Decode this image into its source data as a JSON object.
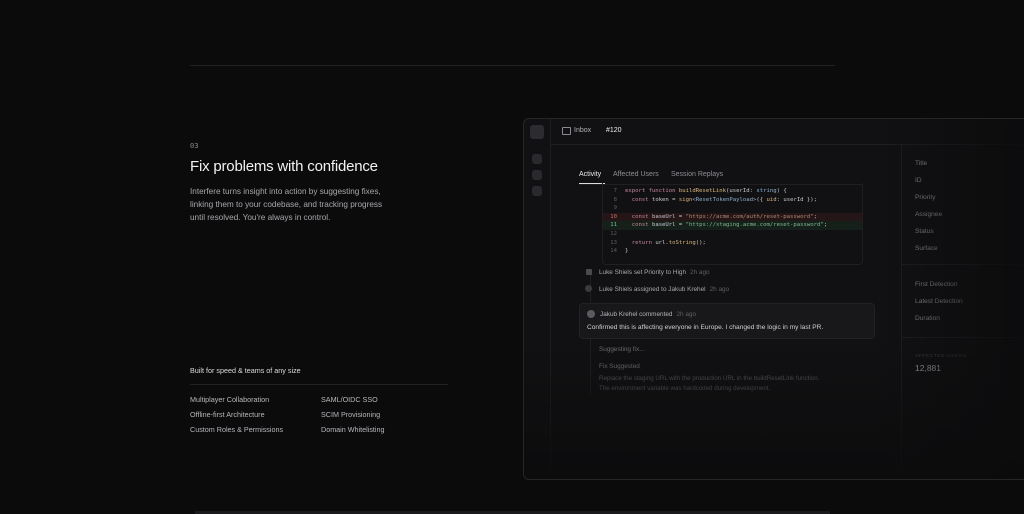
{
  "section": {
    "step": "03",
    "title": "Fix problems with confidence",
    "description": "Interfere turns insight into action by suggesting fixes, linking them to your codebase, and tracking progress until resolved. You're always in control."
  },
  "features": {
    "heading": "Built for speed & teams of any size",
    "left": [
      "Multiplayer Collaboration",
      "Offline-first Architecture",
      "Custom Roles & Permissions"
    ],
    "right": [
      "SAML/OIDC SSO",
      "SCIM Provisioning",
      "Domain Whitelisting"
    ]
  },
  "app": {
    "breadcrumb": "Inbox",
    "issue_id": "#120",
    "tabs": [
      "Activity",
      "Affected Users",
      "Session Replays"
    ],
    "active_tab": "Activity",
    "code": [
      {
        "n": "7",
        "type": "ctx"
      },
      {
        "n": "8",
        "type": "ctx"
      },
      {
        "n": "9",
        "type": "ctx"
      },
      {
        "n": "10",
        "type": "del"
      },
      {
        "n": "11",
        "type": "add"
      },
      {
        "n": "12",
        "type": "ctx"
      },
      {
        "n": "13",
        "type": "ctx"
      },
      {
        "n": "14",
        "type": "ctx"
      }
    ],
    "code_text": {
      "l7_a": "export function ",
      "l7_b": "buildResetLink",
      "l7_c": "(userId: ",
      "l7_d": "string",
      "l7_e": ") {",
      "l8_a": "  const ",
      "l8_b": "token = ",
      "l8_c": "sign",
      "l8_d": "<ResetTokenPayload>",
      "l8_e": "({ ",
      "l8_f": "uid",
      "l8_g": ": userId });",
      "l10_a": "  const ",
      "l10_b": "baseUrl = ",
      "l10_c": "\"https://acme.com/auth/reset-password\"",
      "l10_d": ";",
      "l11_a": "  const ",
      "l11_b": "baseUrl = ",
      "l11_c": "\"https://staging.acme.com/reset-password\"",
      "l11_d": ";",
      "l13_a": "  return ",
      "l13_b": "url.",
      "l13_c": "toString",
      "l13_d": "();",
      "l14_a": "}"
    },
    "activity": [
      {
        "text": "Luke Shiels set Priority to High",
        "ago": "2h ago"
      },
      {
        "text": "Luke Shiels assigned to Jakub Krehel",
        "ago": "2h ago"
      }
    ],
    "comment": {
      "author": "Jakub Krehel commented",
      "ago": "2h ago",
      "body": "Confirmed this is affecting everyone in Europe. I changed the logic in my last PR."
    },
    "suggesting": "Suggesting fix...",
    "fix": {
      "title": "Fix Suggested",
      "line1": "Replace the staging URL with the production URL in the buildResetLink function.",
      "line2": "The environment variable was hardcoded during development."
    },
    "properties": [
      "Title",
      "ID",
      "Priority",
      "Assignee",
      "Status",
      "Surface"
    ],
    "properties2": [
      "First Detection",
      "Latest Detection",
      "Duration"
    ],
    "stat": {
      "label": "AFFECTED USERS",
      "value": "12,881"
    }
  }
}
